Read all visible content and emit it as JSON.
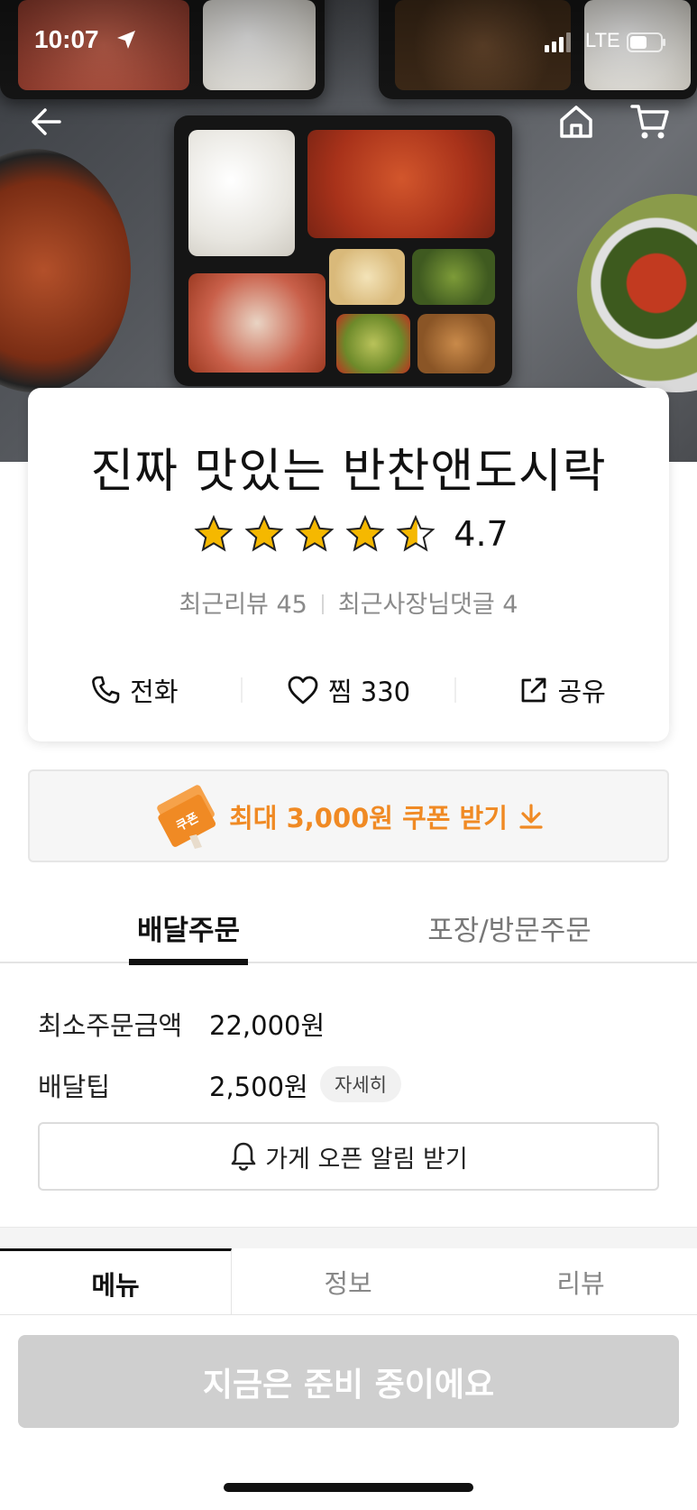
{
  "status_bar": {
    "time": "10:07",
    "network": "LTE"
  },
  "store": {
    "name": "진짜 맛있는 반찬앤도시락",
    "rating": "4.7",
    "stars": 4.7,
    "recent_reviews_label": "최근리뷰 45",
    "owner_comments_label": "최근사장님댓글 4"
  },
  "actions": {
    "call_label": "전화",
    "like_label": "찜 330",
    "share_label": "공유"
  },
  "coupon": {
    "badge_text": "쿠폰",
    "label": "최대 3,000원 쿠폰 받기"
  },
  "order_tabs": {
    "delivery": "배달주문",
    "pickup": "포장/방문주문"
  },
  "delivery_info": {
    "min_order_label": "최소주문금액",
    "min_order_value": "22,000원",
    "tip_label": "배달팁",
    "tip_value": "2,500원",
    "detail_label": "자세히",
    "alarm_label": "가게 오픈 알림 받기"
  },
  "menu_tabs": {
    "menu": "메뉴",
    "info": "정보",
    "review": "리뷰"
  },
  "cta": {
    "label": "지금은 준비 중이에요"
  },
  "colors": {
    "accent": "#f08a24",
    "star": "#f5b800",
    "cta_disabled": "#cfcfcf"
  },
  "icons": [
    "back-arrow-icon",
    "home-icon",
    "cart-icon",
    "phone-icon",
    "heart-icon",
    "share-icon",
    "coupon-icon",
    "download-arrow-icon",
    "bell-icon",
    "location-arrow-icon",
    "signal-icon",
    "battery-icon"
  ]
}
